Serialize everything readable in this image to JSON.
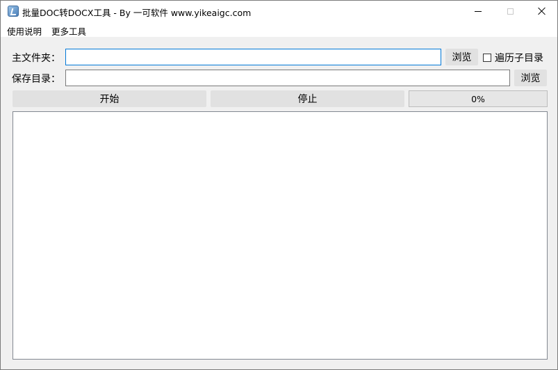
{
  "window": {
    "title": "批量DOC转DOCX工具 - By 一可软件 www.yikeaigc.com",
    "app_icon": "app-logo-icon"
  },
  "menu": {
    "items": [
      {
        "label": "使用说明"
      },
      {
        "label": "更多工具"
      }
    ]
  },
  "form": {
    "main_folder_label": "主文件夹：",
    "main_folder_value": "",
    "save_dir_label": "保存目录：",
    "save_dir_value": "",
    "browse_label": "浏览",
    "recursive_label": "遍历子目录",
    "recursive_checked": false
  },
  "controls": {
    "start_label": "开始",
    "stop_label": "停止"
  },
  "progress": {
    "value": 0,
    "text": "0%",
    "fill_color": "#06b025"
  },
  "log": {
    "content": ""
  }
}
